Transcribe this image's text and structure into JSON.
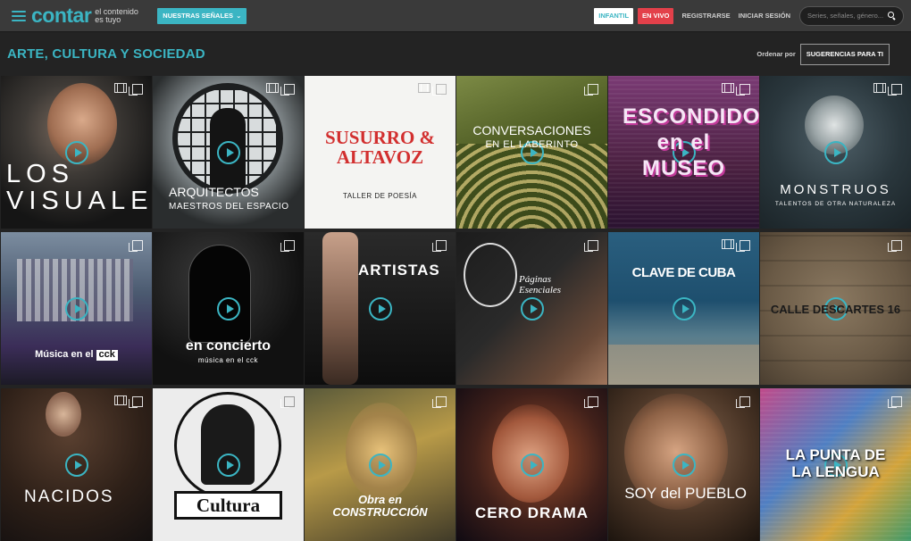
{
  "header": {
    "logo": "contar",
    "tagline": "el contenido es tuyo",
    "signals_label": "NUESTRAS SEÑALES",
    "infantil_label": "INFANTIL",
    "envivo_label": "EN VIVO",
    "register_label": "REGISTRARSE",
    "login_label": "INICIAR SESIÓN",
    "search_placeholder": "Series, señales, género..."
  },
  "section": {
    "title": "ARTE, CULTURA Y SOCIEDAD",
    "order_label": "Ordenar por",
    "order_value": "SUGERENCIAS PARA TI"
  },
  "tiles": [
    {
      "title": "LOS VISUALES",
      "subtitle": ""
    },
    {
      "title": "ARQUITECTOS",
      "subtitle": "MAESTROS DEL ESPACIO"
    },
    {
      "title": "SUSURRO & ALTAVOZ",
      "subtitle": "TALLER DE POESÍA"
    },
    {
      "title": "CONVERSACIONES",
      "subtitle": "EN EL LABERINTO"
    },
    {
      "title": "ESCONDIDOS en el MUSEO",
      "subtitle": ""
    },
    {
      "title": "MONSTRUOS",
      "subtitle": "TALENTOS DE OTRA NATURALEZA"
    },
    {
      "title": "Música en el",
      "subtitle": "cck"
    },
    {
      "title": "en concierto",
      "subtitle": "música en el cck"
    },
    {
      "title": "ARTISTAS",
      "subtitle": ""
    },
    {
      "title": "Páginas Esenciales",
      "subtitle": ""
    },
    {
      "title": "CLAVE DE CUBA",
      "subtitle": ""
    },
    {
      "title": "CALLE DESCARTES 16",
      "subtitle": ""
    },
    {
      "title": "NACIDOS",
      "subtitle": ""
    },
    {
      "title": "Cultura",
      "subtitle": ""
    },
    {
      "title": "Obra en CONSTRUCCIÓN",
      "subtitle": ""
    },
    {
      "title": "CERO DRAMA",
      "subtitle": ""
    },
    {
      "title": "SOY del PUEBLO",
      "subtitle": ""
    },
    {
      "title": "LA PUNTA DE LA LENGUA",
      "subtitle": ""
    }
  ],
  "colors": {
    "accent": "#3bb5c3",
    "live_red": "#e3404a",
    "topbar": "#3a3a3a",
    "background": "#232323"
  },
  "icons": {
    "menu": "hamburger-icon",
    "search": "search-icon",
    "film": "film-icon",
    "copy": "copy-icon",
    "play": "play-icon"
  }
}
